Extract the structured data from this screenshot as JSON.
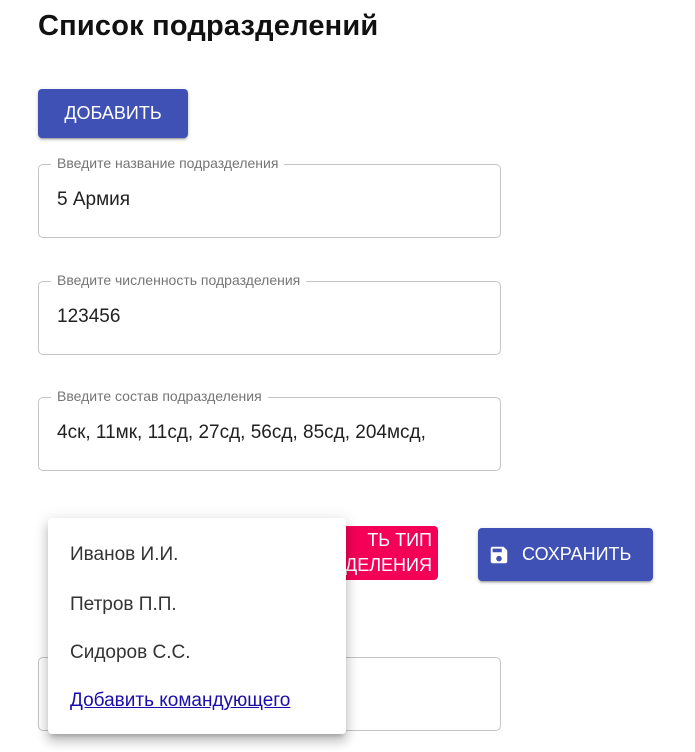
{
  "page": {
    "title": "Список подразделений"
  },
  "toolbar": {
    "add_label": "ДОБАВИТЬ"
  },
  "form": {
    "name_field": {
      "label": "Введите название подразделения",
      "value": "5 Армия"
    },
    "strength_field": {
      "label": "Введите численность подразделения",
      "value": "123456"
    },
    "composition_field": {
      "label": "Введите состав подразделения",
      "value": "4ск, 11мк, 11сд, 27сд, 56сд, 85сд, 204мсд,"
    },
    "type_button": {
      "line1": "ТЬ ТИП",
      "line2": "ДЕЛЕНИЯ"
    },
    "save_button": {
      "label": "СОХРАНИТЬ",
      "icon": "save-icon"
    }
  },
  "commander_menu": {
    "items": [
      "Иванов И.И.",
      "Петров П.П.",
      "Сидоров С.С."
    ],
    "add_link": "Добавить командующего"
  },
  "colors": {
    "primary": "#3f51b5",
    "secondary": "#f50057",
    "link": "#1a0dab"
  }
}
